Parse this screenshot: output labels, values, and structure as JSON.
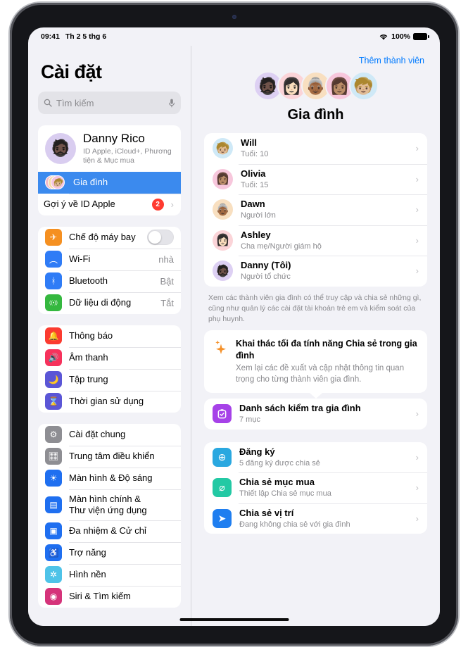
{
  "status_bar": {
    "time": "09:41",
    "date": "Th 2 5 thg 6",
    "battery_percent": "100%",
    "wifi_icon": "wifi-icon",
    "battery_icon": "battery-icon"
  },
  "sidebar": {
    "title": "Cài đặt",
    "search": {
      "placeholder": "Tìm kiếm",
      "value": "",
      "search_icon": "search-icon",
      "mic_icon": "microphone-icon"
    },
    "account": {
      "name": "Danny Rico",
      "subtitle": "ID Apple, iCloud+, Phương tiện & Mục mua",
      "avatar_emoji": "🧔🏿",
      "avatar_bg": "#d9cdf0"
    },
    "family_row": {
      "label": "Gia đình",
      "selected": true,
      "accent": "#3b8aee"
    },
    "suggestion_row": {
      "label": "Gợi ý về ID Apple",
      "badge": "2",
      "badge_color": "#ff3b30"
    },
    "groups": [
      {
        "items": [
          {
            "label": "Chế độ máy bay",
            "value": "",
            "icon": "airplane-icon",
            "glyph": "✈",
            "color": "#f59021",
            "control": "toggle",
            "toggle_on": false
          },
          {
            "label": "Wi-Fi",
            "value": "nhà",
            "icon": "wifi-icon",
            "glyph": "︵",
            "color": "#2f7cf6",
            "control": "value"
          },
          {
            "label": "Bluetooth",
            "value": "Bật",
            "icon": "bluetooth-icon",
            "glyph": "ᚼ",
            "color": "#2f7cf6",
            "control": "value"
          },
          {
            "label": "Dữ liệu di động",
            "value": "Tắt",
            "icon": "cellular-icon",
            "glyph": "((•))",
            "color": "#35b83f",
            "control": "value"
          }
        ]
      },
      {
        "items": [
          {
            "label": "Thông báo",
            "value": "",
            "icon": "bell-icon",
            "glyph": "🔔",
            "color": "#fb3b30",
            "control": "none"
          },
          {
            "label": "Âm thanh",
            "value": "",
            "icon": "speaker-icon",
            "glyph": "🔊",
            "color": "#f6325c",
            "control": "none"
          },
          {
            "label": "Tập trung",
            "value": "",
            "icon": "moon-icon",
            "glyph": "🌙",
            "color": "#5b56d6",
            "control": "none"
          },
          {
            "label": "Thời gian sử dụng",
            "value": "",
            "icon": "hourglass-icon",
            "glyph": "⌛",
            "color": "#5b56d6",
            "control": "none"
          }
        ]
      },
      {
        "items": [
          {
            "label": "Cài đặt chung",
            "value": "",
            "icon": "gear-icon",
            "glyph": "⚙",
            "color": "#8e8e93",
            "control": "none"
          },
          {
            "label": "Trung tâm điều khiển",
            "value": "",
            "icon": "control-center-icon",
            "glyph": "🎛",
            "color": "#8e8e93",
            "control": "none"
          },
          {
            "label": "Màn hình & Độ sáng",
            "value": "",
            "icon": "brightness-icon",
            "glyph": "☀",
            "color": "#1f6ff0",
            "control": "none"
          },
          {
            "label": "Màn hình chính &\nThư viện ứng dụng",
            "value": "",
            "icon": "home-screen-icon",
            "glyph": "▤",
            "color": "#1f6ff0",
            "control": "none"
          },
          {
            "label": "Đa nhiệm & Cử chỉ",
            "value": "",
            "icon": "multitasking-icon",
            "glyph": "▣",
            "color": "#1f6ff0",
            "control": "none"
          },
          {
            "label": "Trợ năng",
            "value": "",
            "icon": "accessibility-icon",
            "glyph": "♿",
            "color": "#1f6ff0",
            "control": "none"
          },
          {
            "label": "Hình nền",
            "value": "",
            "icon": "wallpaper-icon",
            "glyph": "✲",
            "color": "#4ec3e8",
            "control": "none"
          },
          {
            "label": "Siri & Tìm kiếm",
            "value": "",
            "icon": "siri-icon",
            "glyph": "◉",
            "color": "#d5337a",
            "control": "none"
          }
        ]
      }
    ]
  },
  "detail": {
    "add_member_link": "Thêm thành viên",
    "title": "Gia đình",
    "hero_avatars": [
      {
        "emoji": "🧔🏿",
        "bg": "#ddd0f3"
      },
      {
        "emoji": "👩🏻",
        "bg": "#fbd4d8"
      },
      {
        "emoji": "👵🏾",
        "bg": "#f8dfc0"
      },
      {
        "emoji": "👩🏽",
        "bg": "#f7c7dc"
      },
      {
        "emoji": "🧒🏼",
        "bg": "#cfe9f7"
      }
    ],
    "members": [
      {
        "name": "Will",
        "role": "Tuổi: 10",
        "emoji": "🧒🏼",
        "bg": "#cfe9f7"
      },
      {
        "name": "Olivia",
        "role": "Tuổi: 15",
        "emoji": "👩🏽",
        "bg": "#f7c7dc"
      },
      {
        "name": "Dawn",
        "role": "Người lớn",
        "emoji": "👵🏾",
        "bg": "#f8dfc0"
      },
      {
        "name": "Ashley",
        "role": "Cha mẹ/Người giám hộ",
        "emoji": "👩🏻",
        "bg": "#fbd4d8"
      },
      {
        "name": "Danny (Tôi)",
        "role": "Người tổ chức",
        "emoji": "🧔🏿",
        "bg": "#ddd0f3"
      }
    ],
    "footnote": "Xem các thành viên gia đình có thể truy cập và chia sẻ những gì, cũng như quản lý các cài đặt tài khoản trẻ em và kiểm soát của phụ huynh.",
    "promo": {
      "title": "Khai thác tối đa tính năng Chia sẻ trong gia đình",
      "subtitle": "Xem lại các đề xuất và cập nhật thông tin quan trọng cho từng thành viên gia đình.",
      "icon": "sparkles-icon",
      "icon_color": "#f5912a"
    },
    "checklist": {
      "title": "Danh sách kiểm tra gia đình",
      "subtitle": "7 mục",
      "icon": "checklist-icon",
      "color": "#a642e8",
      "glyph": "☑"
    },
    "services": [
      {
        "title": "Đăng ký",
        "subtitle": "5 đăng ký được chia sẻ",
        "icon": "subscriptions-icon",
        "color": "#2aa8e0",
        "glyph": "⊕"
      },
      {
        "title": "Chia sẻ mục mua",
        "subtitle": "Thiết lập Chia sẻ mục mua",
        "icon": "purchase-sharing-icon",
        "color": "#23c9a4",
        "glyph": "⌀"
      },
      {
        "title": "Chia sẻ vị trí",
        "subtitle": "Đang không chia sẻ với gia đình",
        "icon": "location-sharing-icon",
        "color": "#1f7ef0",
        "glyph": "➤"
      }
    ],
    "chevron": "›"
  }
}
